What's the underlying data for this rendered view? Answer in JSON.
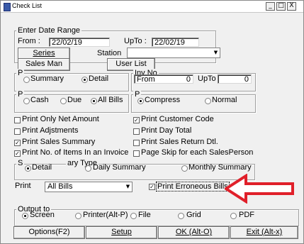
{
  "window": {
    "title": "Check List",
    "min_label": "_",
    "max_label": "□",
    "close_label": "X"
  },
  "date_range": {
    "group_label": "Enter Date Range",
    "from_label": "From :",
    "from_value": "22/02/19",
    "upto_label": "UpTo :",
    "upto_value": "22/02/19"
  },
  "filters": {
    "series_button": "Series",
    "station_label": "Station",
    "station_value": "",
    "salesman_button": "Sales Man",
    "userlist_button": "User List"
  },
  "print_mode": {
    "group_label": "P",
    "options": [
      "Summary",
      "Detail"
    ],
    "selected": "Detail"
  },
  "inv_no": {
    "group_label": "Inv No",
    "from_label": "From",
    "from_value": "0",
    "upto_label": "UpTo",
    "upto_value": "0"
  },
  "bill_type": {
    "group_label": "P",
    "options": [
      "Cash",
      "Due",
      "All Bills"
    ],
    "selected": "All Bills"
  },
  "compress_group": {
    "group_label": "P",
    "options": [
      "Compress",
      "Normal"
    ],
    "selected": "Compress"
  },
  "checkboxes_left": [
    {
      "label": "Print Only Net Amount",
      "checked": false
    },
    {
      "label": "Print Adjstments",
      "checked": false
    },
    {
      "label": "Print Sales Summary",
      "checked": true
    },
    {
      "label": "Print No. of Items In an Invoice",
      "checked": true
    }
  ],
  "checkboxes_right": [
    {
      "label": "Print Customer Code",
      "checked": true
    },
    {
      "label": "Print Day Total",
      "checked": false
    },
    {
      "label": "Print Sales Return Dtl.",
      "checked": false
    },
    {
      "label": "Page Skip for each SalesPerson",
      "checked": false
    }
  ],
  "summary_type": {
    "group_label": "S",
    "group_label_tail": "ary Type",
    "options": [
      "Detail",
      "Daily Summary",
      "Monthly Summary"
    ],
    "selected": "Detail"
  },
  "print_row": {
    "label": "Print",
    "select_value": "All Bills",
    "erroneous_label": "Print Erroneous Bills",
    "erroneous_checked": true
  },
  "output": {
    "group_label": "Output to",
    "options": [
      "Screen",
      "Printer(Alt-P)",
      "File",
      "Grid",
      "PDF"
    ],
    "selected": "Screen"
  },
  "bottom_buttons": {
    "options": "Options(F2)",
    "setup": "Setup",
    "ok": "OK (Alt-O)",
    "exit": "Exit (Alt-x)"
  },
  "colors": {
    "window_bg": "#f0f0f0",
    "annotation_arrow": "#e0202a"
  },
  "icons": {
    "app": "app-icon",
    "annotation": "red-arrow-annotation"
  }
}
